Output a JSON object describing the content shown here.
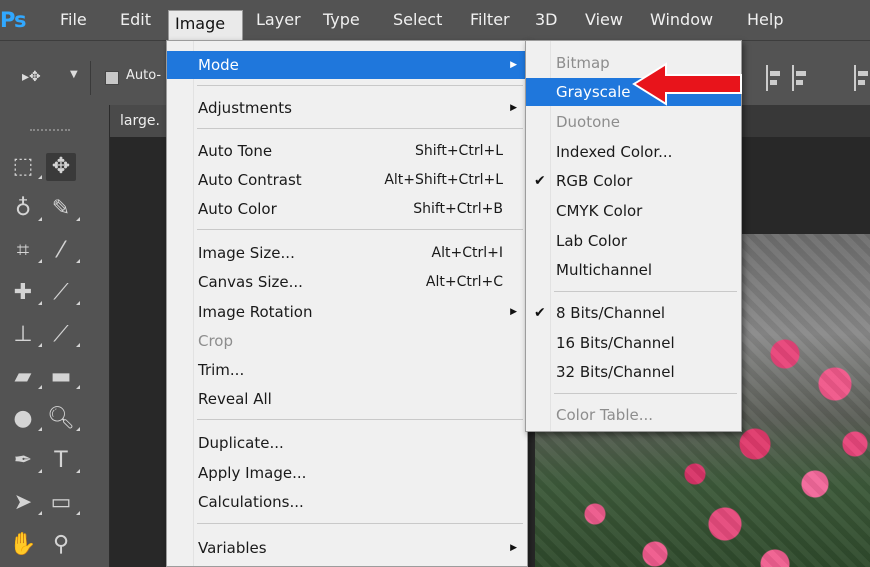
{
  "app": {
    "logo": "Ps"
  },
  "menubar": {
    "items": [
      {
        "label": "File"
      },
      {
        "label": "Edit"
      },
      {
        "label": "Image"
      },
      {
        "label": "Layer"
      },
      {
        "label": "Type"
      },
      {
        "label": "Select"
      },
      {
        "label": "Filter"
      },
      {
        "label": "3D"
      },
      {
        "label": "View"
      },
      {
        "label": "Window"
      },
      {
        "label": "Help"
      }
    ]
  },
  "options": {
    "auto_label": "Auto-"
  },
  "tabs": {
    "doc_label": "large."
  },
  "image_menu": {
    "items": [
      {
        "label": "Mode",
        "shortcut": "",
        "submenu": true,
        "highlighted": true
      },
      {
        "label": "Adjustments",
        "shortcut": "",
        "submenu": true
      },
      {
        "label": "Auto Tone",
        "shortcut": "Shift+Ctrl+L"
      },
      {
        "label": "Auto Contrast",
        "shortcut": "Alt+Shift+Ctrl+L"
      },
      {
        "label": "Auto Color",
        "shortcut": "Shift+Ctrl+B"
      },
      {
        "label": "Image Size...",
        "shortcut": "Alt+Ctrl+I"
      },
      {
        "label": "Canvas Size...",
        "shortcut": "Alt+Ctrl+C"
      },
      {
        "label": "Image Rotation",
        "shortcut": "",
        "submenu": true
      },
      {
        "label": "Crop",
        "shortcut": "",
        "disabled": true
      },
      {
        "label": "Trim...",
        "shortcut": ""
      },
      {
        "label": "Reveal All",
        "shortcut": ""
      },
      {
        "label": "Duplicate...",
        "shortcut": ""
      },
      {
        "label": "Apply Image...",
        "shortcut": ""
      },
      {
        "label": "Calculations...",
        "shortcut": ""
      },
      {
        "label": "Variables",
        "shortcut": "",
        "submenu": true
      }
    ]
  },
  "mode_menu": {
    "items": [
      {
        "label": "Bitmap",
        "disabled": true
      },
      {
        "label": "Grayscale",
        "highlighted": true
      },
      {
        "label": "Duotone",
        "disabled": true
      },
      {
        "label": "Indexed Color..."
      },
      {
        "label": "RGB Color",
        "checked": true
      },
      {
        "label": "CMYK Color"
      },
      {
        "label": "Lab Color"
      },
      {
        "label": "Multichannel"
      },
      {
        "label": "8 Bits/Channel",
        "checked": true
      },
      {
        "label": "16 Bits/Channel"
      },
      {
        "label": "32 Bits/Channel"
      },
      {
        "label": "Color Table...",
        "disabled": true
      }
    ]
  },
  "glyphs": {
    "check": "✔",
    "submenu_arrow": "▶"
  },
  "colors": {
    "highlight": "#1f77dc",
    "menu_bg": "#f0f0f0",
    "app_bg": "#535353",
    "annotation_arrow": "#e8141b",
    "logo": "#31a8ff"
  }
}
